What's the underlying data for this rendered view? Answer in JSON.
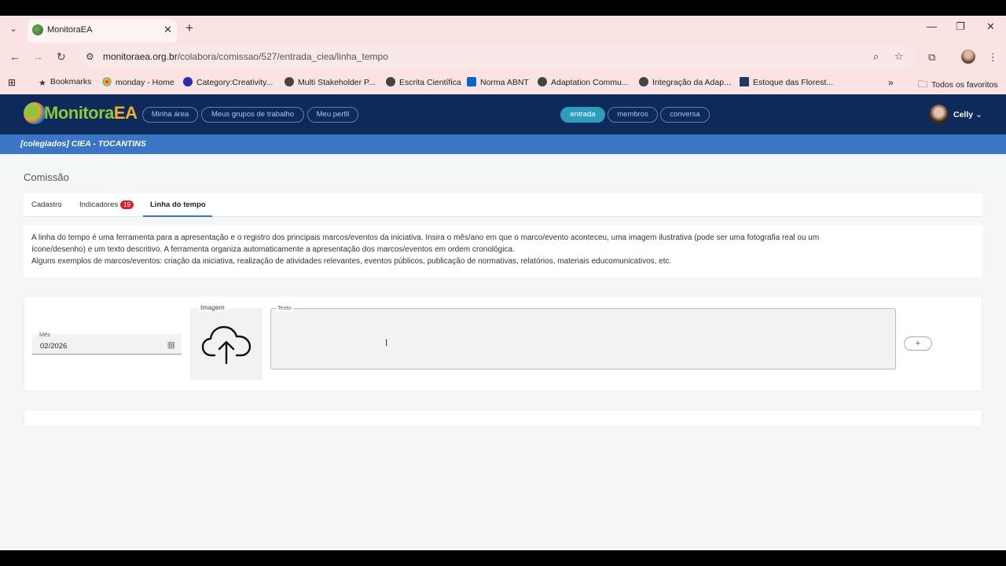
{
  "browser": {
    "tab_title": "MonitoraEA",
    "url_host": "monitoraea.org.br",
    "url_path": "/colabora/comissao/527/entrada_ciea/linha_tempo",
    "bookmarks": [
      {
        "label": "Bookmarks",
        "icon": "star-icon"
      },
      {
        "label": "monday - Home",
        "icon": "monday-icon"
      },
      {
        "label": "Category:Creativity...",
        "icon": "m-icon"
      },
      {
        "label": "Multi Stakeholder P...",
        "icon": "globe-icon"
      },
      {
        "label": "Escrita Científica",
        "icon": "globe-icon"
      },
      {
        "label": "Norma ABNT",
        "icon": "linkedin-icon"
      },
      {
        "label": "Adaptation Commu...",
        "icon": "globe-icon"
      },
      {
        "label": "Integração da Adap...",
        "icon": "globe-icon"
      },
      {
        "label": "Estoque das Florest...",
        "icon": "flag-icon"
      }
    ],
    "all_bookmarks": "Todos os favoritos"
  },
  "app": {
    "logo_left": "Monitora",
    "logo_right": "EA",
    "nav_left": [
      "Minha área",
      "Meus grupos de trabalho",
      "Meu perfil"
    ],
    "nav_center": [
      "entrada",
      "membros",
      "conversa"
    ],
    "active_center": "entrada",
    "user_name": "Celly",
    "context": "[colegiados] CIEA - TOCANTINS"
  },
  "main": {
    "heading": "Comissão",
    "tabs": [
      {
        "label": "Cadastro"
      },
      {
        "label": "Indicadores",
        "badge": "19"
      },
      {
        "label": "Linha do tempo"
      }
    ],
    "description_lines": [
      "A linha do tempo é uma ferramenta para a apresentação e o registro dos principais marcos/eventos da iniciativa. Insira o mês/ano em que o marco/evento aconteceu, uma imagem ilustrativa (pode ser uma fotografia real ou um",
      "ícone/desenho) e um texto descritivo. A ferramenta organiza automaticamente a apresentação dos marcos/eventos em ordem cronológica.",
      "Alguns exemplos de marcos/eventos: criação da iniciativa, realização de atividades relevantes, eventos públicos, publicação de normativas, relatórios, materiais educomunicativos, etc."
    ],
    "form": {
      "mes_label": "Mês",
      "mes_value": "02/2026",
      "imagem_label": "Imagem",
      "texto_label": "Texto",
      "add_label": "+"
    }
  }
}
